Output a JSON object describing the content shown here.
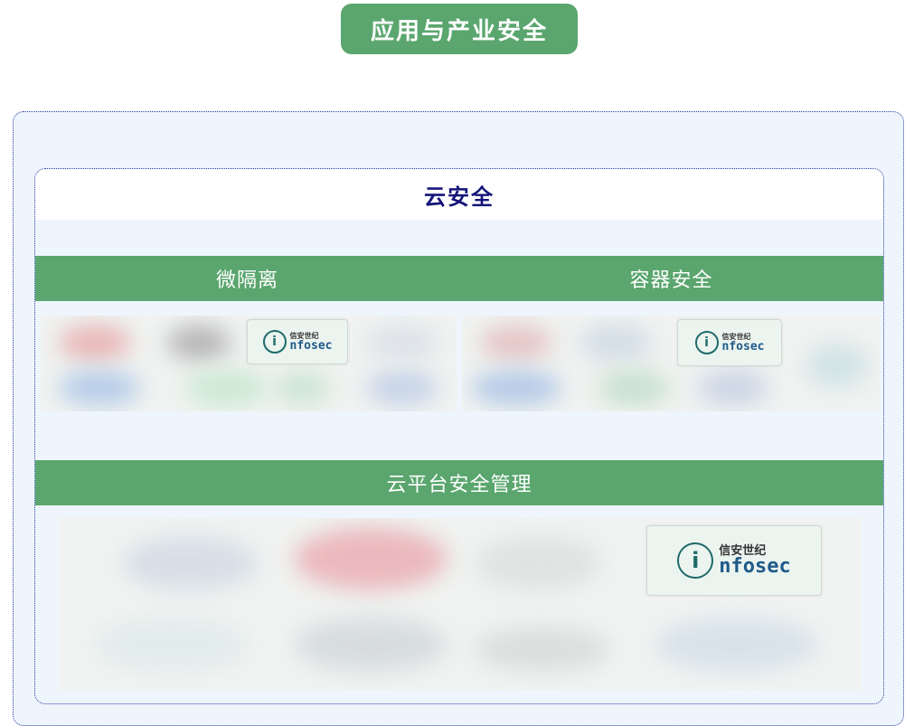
{
  "header": {
    "title": "应用与产业安全"
  },
  "panel": {
    "title": "云安全",
    "sections": [
      {
        "label": "微隔离"
      },
      {
        "label": "容器安全"
      },
      {
        "label": "云平台安全管理"
      }
    ]
  },
  "logo": {
    "cn": "信安世纪",
    "en": "nfosec",
    "mark": "i"
  },
  "colors": {
    "accent_green": "#5aa66e",
    "title_navy": "#14147a",
    "panel_bg": "#eef5fd"
  }
}
